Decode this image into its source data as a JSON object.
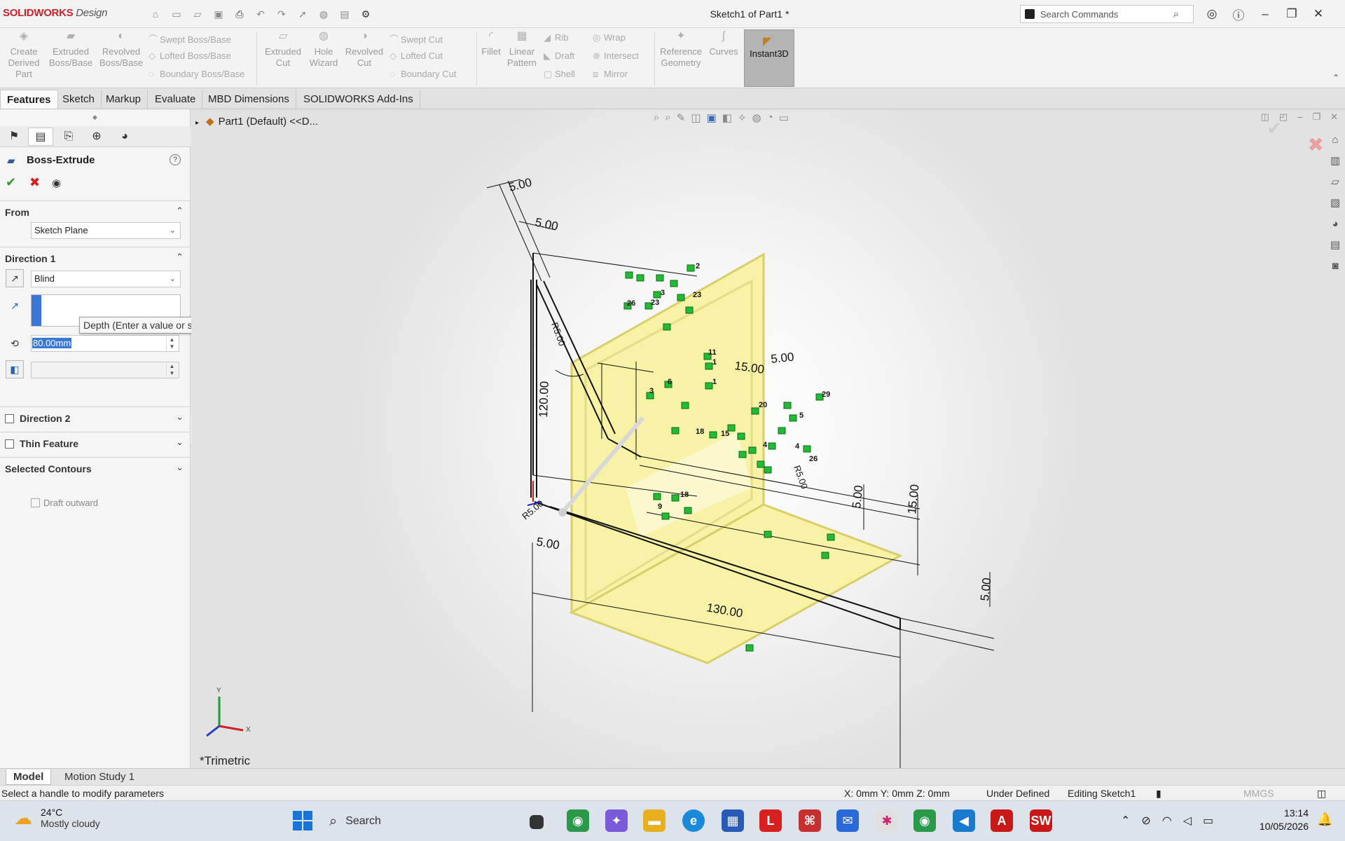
{
  "app": {
    "brand": "SOLIDWORKS",
    "brand_suffix": "Design",
    "document_title": "Sketch1 of Part1 *"
  },
  "search": {
    "placeholder": "Search Commands"
  },
  "ribbon": {
    "buttons": [
      {
        "label": "Create Derived Part"
      },
      {
        "label": "Extruded Boss/Base"
      },
      {
        "label": "Revolved Boss/Base"
      },
      {
        "label": "Extruded Cut"
      },
      {
        "label": "Hole Wizard"
      },
      {
        "label": "Revolved Cut"
      },
      {
        "label": "Fillet"
      },
      {
        "label": "Linear Pattern"
      },
      {
        "label": "Reference Geometry"
      },
      {
        "label": "Curves"
      },
      {
        "label": "Instant3D"
      }
    ],
    "small": [
      {
        "label": "Swept Boss/Base"
      },
      {
        "label": "Lofted Boss/Base"
      },
      {
        "label": "Boundary Boss/Base"
      },
      {
        "label": "Swept Cut"
      },
      {
        "label": "Lofted Cut"
      },
      {
        "label": "Boundary Cut"
      },
      {
        "label": "Rib"
      },
      {
        "label": "Draft"
      },
      {
        "label": "Shell"
      },
      {
        "label": "Wrap"
      },
      {
        "label": "Intersect"
      },
      {
        "label": "Mirror"
      }
    ]
  },
  "tabs": [
    {
      "label": "Features"
    },
    {
      "label": "Sketch"
    },
    {
      "label": "Markup"
    },
    {
      "label": "Evaluate"
    },
    {
      "label": "MBD Dimensions"
    },
    {
      "label": "SOLIDWORKS Add-Ins"
    }
  ],
  "property_manager": {
    "title": "Boss-Extrude",
    "help": "?",
    "from": {
      "header": "From",
      "value": "Sketch Plane"
    },
    "direction1": {
      "header": "Direction 1",
      "end_condition": "Blind",
      "depth": "80.00mm",
      "draft_outward": "Draft outward"
    },
    "tooltip": "Depth (Enter a value or start with = to create an equation)",
    "direction2": {
      "header": "Direction 2"
    },
    "thin_feature": {
      "header": "Thin Feature"
    },
    "selected_contours": {
      "header": "Selected Contours"
    }
  },
  "viewport": {
    "tree_item": "Part1 (Default) <<D...",
    "view_name": "*Trimetric",
    "dimensions": [
      "5.00",
      "5.00",
      "120.00",
      "15.00",
      "5.00",
      "5.00",
      "15.00",
      "5.00",
      "130.00",
      "5.00",
      "R5.00",
      "R5.00",
      "R5.00"
    ],
    "relation_numbers": [
      "2",
      "23",
      "26",
      "23",
      "3",
      "11",
      "1",
      "1",
      "6",
      "3",
      "29",
      "20",
      "5",
      "4",
      "18",
      "15",
      "4",
      "26",
      "18",
      "9"
    ],
    "triad": {
      "x": "X",
      "y": "Y"
    }
  },
  "bottom_tabs": [
    {
      "label": "Model"
    },
    {
      "label": "Motion Study 1"
    }
  ],
  "status": {
    "message": "Select a handle to modify parameters",
    "coords": "X: 0mm Y: 0mm Z: 0mm",
    "definition": "Under Defined",
    "editing": "Editing Sketch1",
    "units": "MMGS"
  },
  "taskbar": {
    "temperature": "24°C",
    "weather": "Mostly cloudy",
    "search": "Search",
    "time": "13:14",
    "date": "10/05/2026"
  },
  "colors": {
    "accent": "#3a78d8",
    "brand": "#d0202a",
    "part_yellow": "#f6f2a0",
    "relation_green": "#22bb33"
  }
}
